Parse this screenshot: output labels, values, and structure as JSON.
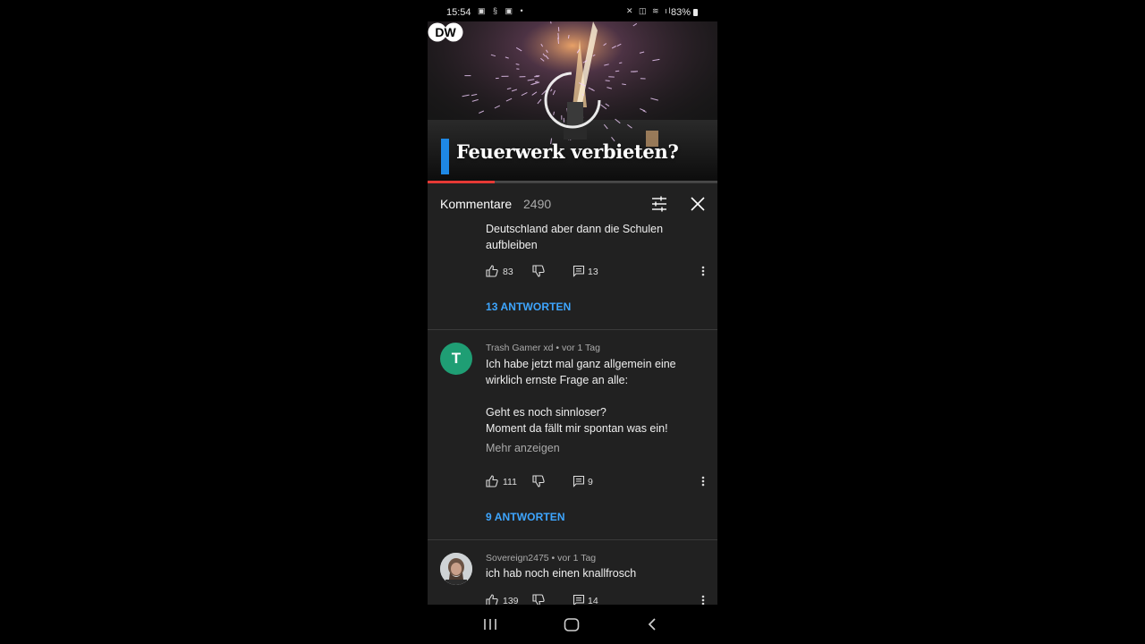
{
  "status_bar": {
    "time": "15:54",
    "battery": "83%",
    "left_icons": [
      "gallery-icon",
      "sync-icon",
      "gallery-icon",
      "dot-icon"
    ],
    "right_icons": [
      "mute-icon",
      "alarm-icon",
      "wifi-icon",
      "signal-icon",
      "battery-icon"
    ]
  },
  "video": {
    "channel_logo": "DW",
    "title": "Feuerwerk verbieten?",
    "progress": 0.23,
    "accent_color": "#1e88e5",
    "progress_color": "#e53935"
  },
  "comments_header": {
    "title": "Kommentare",
    "count": "2490",
    "filter_icon": "filter-icon",
    "close_icon": "close-icon"
  },
  "comments": [
    {
      "text_lines": [
        "Deutschland aber dann die Schulen",
        "aufbleiben"
      ],
      "likes": "83",
      "replies_count": "13",
      "replies_label": "13 ANTWORTEN"
    },
    {
      "avatar_letter": "T",
      "avatar_color": "#1f9e74",
      "meta": "Trash Gamer xd • vor 1 Tag",
      "text_lines": [
        "Ich habe jetzt mal ganz allgemein eine",
        "wirklich ernste Frage an alle:",
        "",
        "Geht es noch sinnloser?",
        "Moment da fällt mir spontan was ein!"
      ],
      "show_more": "Mehr anzeigen",
      "likes": "111",
      "replies_count": "9",
      "replies_label": "9 ANTWORTEN"
    },
    {
      "avatar": "profile-photo",
      "meta": "Sovereign2475 • vor 1 Tag",
      "text_lines": [
        "ich hab noch einen knallfrosch"
      ],
      "likes": "139",
      "replies_count": "14"
    }
  ],
  "nav_bar": {
    "icons": [
      "recents-icon",
      "home-icon",
      "back-icon"
    ]
  },
  "colors": {
    "panel_bg": "#212121",
    "link_blue": "#3ea6ff"
  }
}
